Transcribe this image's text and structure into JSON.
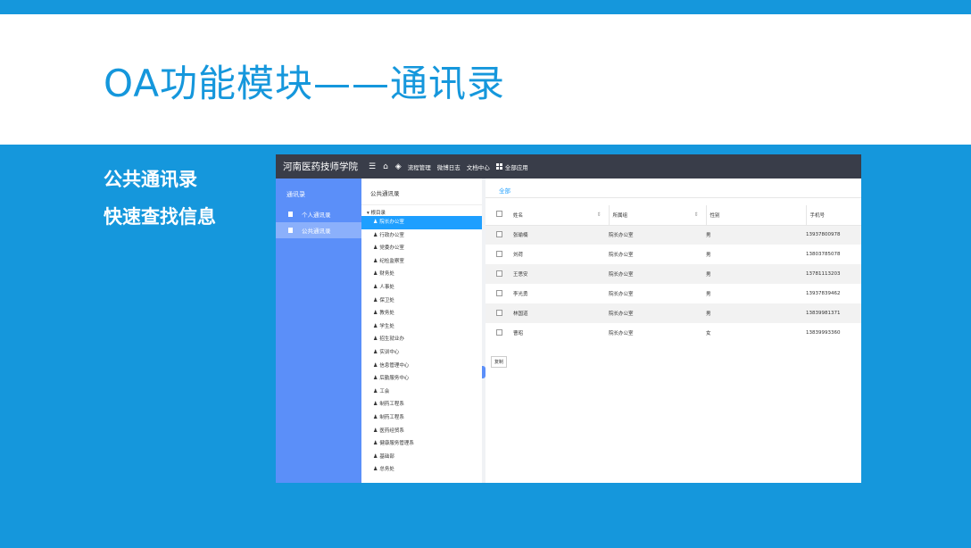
{
  "slide": {
    "title": "OA功能模块——通讯录",
    "bullets": [
      "公共通讯录",
      "快速查找信息"
    ]
  },
  "app": {
    "logo": "河南医药技师学院",
    "header_icons": [
      "menu-icon",
      "home-icon",
      "layers-icon",
      "grid-icon"
    ],
    "nav": [
      "流程管理",
      "微博日志",
      "文档中心",
      "全部应用"
    ],
    "sidebar": {
      "title": "通讯录",
      "items": [
        {
          "label": "个人通讯录",
          "active": false
        },
        {
          "label": "公共通讯录",
          "active": true
        }
      ]
    },
    "tree": {
      "title": "公共通讯录",
      "root": "▾ 根目录",
      "nodes": [
        "院长办公室",
        "行政办公室",
        "党委办公室",
        "纪检监察室",
        "财务处",
        "人事处",
        "保卫处",
        "教务处",
        "学生处",
        "招生就业办",
        "实训中心",
        "信息管理中心",
        "后勤服务中心",
        "工会",
        "制药工程系",
        "制药工程系",
        "医药经贸系",
        "健康服务管理系",
        "基础部",
        "总务处"
      ]
    },
    "tabs": [
      "全部"
    ],
    "table": {
      "columns": [
        "姓名",
        "所属组",
        "性别",
        "手机号"
      ],
      "rows": [
        {
          "name": "张瑜楠",
          "group": "院长办公室",
          "gender": "男",
          "phone": "13937800978"
        },
        {
          "name": "刘荷",
          "group": "院长办公室",
          "gender": "男",
          "phone": "13803785078"
        },
        {
          "name": "王思安",
          "group": "院长办公室",
          "gender": "男",
          "phone": "13781113203"
        },
        {
          "name": "李光勇",
          "group": "院长办公室",
          "gender": "男",
          "phone": "13937839462"
        },
        {
          "name": "林国道",
          "group": "院长办公室",
          "gender": "男",
          "phone": "13839981371"
        },
        {
          "name": "曹昭",
          "group": "院长办公室",
          "gender": "女",
          "phone": "13839993360"
        }
      ]
    },
    "copy_button": "复制"
  },
  "colors": {
    "slide_blue": "#1597dc",
    "header_dark": "#393d49",
    "sidebar_blue": "#5b8ff9",
    "active_blue": "#1e9fff"
  }
}
